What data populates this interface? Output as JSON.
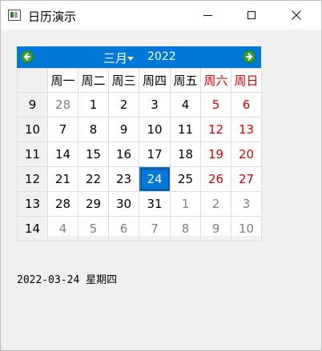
{
  "window": {
    "title": "日历演示",
    "icons": {
      "app": "calendar-app-icon",
      "min": "minimize-icon",
      "max": "maximize-icon",
      "close": "close-icon"
    }
  },
  "calendar": {
    "header": {
      "month": "三月",
      "year": "2022",
      "prev_icon": "left-arrow-icon",
      "next_icon": "right-arrow-icon",
      "accent": "#0078d7"
    },
    "weekdays": [
      "周一",
      "周二",
      "周三",
      "周四",
      "周五",
      "周六",
      "周日"
    ],
    "weeks": [
      {
        "num": "9",
        "days": [
          "28",
          "1",
          "2",
          "3",
          "4",
          "5",
          "6"
        ]
      },
      {
        "num": "10",
        "days": [
          "7",
          "8",
          "9",
          "10",
          "11",
          "12",
          "13"
        ]
      },
      {
        "num": "11",
        "days": [
          "14",
          "15",
          "16",
          "17",
          "18",
          "19",
          "20"
        ]
      },
      {
        "num": "12",
        "days": [
          "21",
          "22",
          "23",
          "24",
          "25",
          "26",
          "27"
        ]
      },
      {
        "num": "13",
        "days": [
          "28",
          "29",
          "30",
          "31",
          "1",
          "2",
          "3"
        ]
      },
      {
        "num": "14",
        "days": [
          "4",
          "5",
          "6",
          "7",
          "8",
          "9",
          "10"
        ]
      }
    ],
    "selected_date": "24",
    "weekend_color": "#d40000",
    "other_month_color": "#808080"
  },
  "status": {
    "text": "2022-03-24 星期四"
  }
}
